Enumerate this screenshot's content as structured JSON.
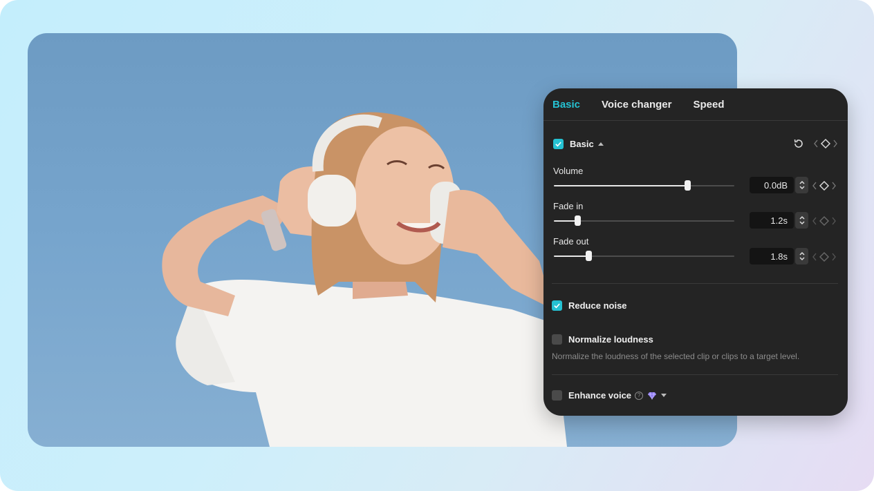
{
  "tabs": [
    {
      "label": "Basic",
      "active": true
    },
    {
      "label": "Voice changer",
      "active": false
    },
    {
      "label": "Speed",
      "active": false
    }
  ],
  "basic_section": {
    "label": "Basic",
    "enabled": true,
    "icons": [
      "reset-icon",
      "keyframe-prev-icon",
      "keyframe-icon",
      "keyframe-next-icon"
    ]
  },
  "volume": {
    "label": "Volume",
    "value": "0.0dB",
    "slider_fraction": 0.74
  },
  "fade_in": {
    "label": "Fade in",
    "value": "1.2s",
    "slider_fraction": 0.13
  },
  "fade_out": {
    "label": "Fade out",
    "value": "1.8s",
    "slider_fraction": 0.19
  },
  "reduce_noise": {
    "label": "Reduce noise",
    "checked": true
  },
  "normalize_loudness": {
    "label": "Normalize loudness",
    "checked": false,
    "description": "Normalize the loudness of the selected clip or clips to a target level."
  },
  "enhance_voice": {
    "label": "Enhance voice",
    "checked": false,
    "icons": [
      "help-icon",
      "premium-gem-icon",
      "chevron-down-icon"
    ]
  },
  "colors": {
    "accent": "#25c2d3",
    "panel_bg": "#242424",
    "sky": "#77a5cd"
  }
}
